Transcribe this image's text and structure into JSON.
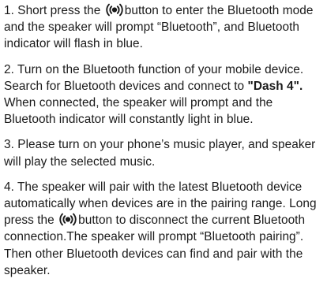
{
  "paragraphs": {
    "p1": {
      "before_icon": "1. Short press the ",
      "icon": "broadcast-icon",
      "after_icon": "button to enter the Bluetooth mode and the speaker will prompt “Bluetooth”, and Bluetooth indicator will flash in blue."
    },
    "p2": {
      "before_bold": "2. Turn on the Bluetooth function of your mobile device. Search for Bluetooth devices and connect to ",
      "bold": "\"Dash 4\".",
      "after_bold": " When connected, the speaker will prompt and the Bluetooth indicator will constantly light in blue."
    },
    "p3": {
      "text": "3. Please turn on your phone’s music player, and speaker will play the selected music."
    },
    "p4": {
      "before_icon": "4. The speaker will pair with the latest Bluetooth device automatically when devices are in the pairing range. Long press the ",
      "icon": "broadcast-icon",
      "after_icon": "button to disconnect the current Bluetooth connection.The speaker will prompt “Bluetooth pairing”. Then other Bluetooth devices can find and pair with the speaker."
    }
  }
}
